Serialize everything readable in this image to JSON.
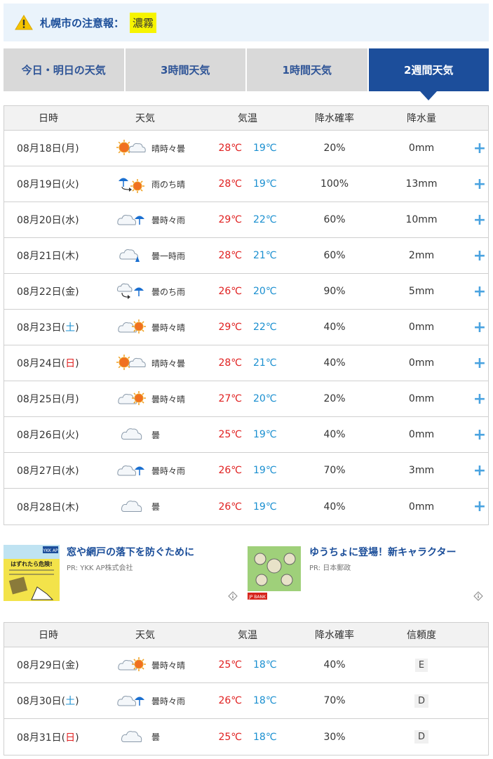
{
  "alert": {
    "label": "札幌市の注意報：",
    "badge": "濃霧",
    "icon": "warning-icon"
  },
  "tabs": [
    {
      "label": "今日・明日の天気",
      "active": false
    },
    {
      "label": "3時間天気",
      "active": false
    },
    {
      "label": "1時間天気",
      "active": false
    },
    {
      "label": "2週間天気",
      "active": true
    }
  ],
  "table1": {
    "headers": {
      "date": "日時",
      "weather": "天気",
      "temp": "気温",
      "pop": "降水確率",
      "amount": "降水量"
    },
    "rows": [
      {
        "date": "08月18日(",
        "dow": "月",
        "tail": ")",
        "icon": "sun-cloud-icon",
        "weather": "晴時々曇",
        "hi": "28℃",
        "lo": "19℃",
        "pop": "20%",
        "amount": "0mm"
      },
      {
        "date": "08月19日(",
        "dow": "火",
        "tail": ")",
        "icon": "rain-then-sun-icon",
        "weather": "雨のち晴",
        "hi": "28℃",
        "lo": "19℃",
        "pop": "100%",
        "amount": "13mm"
      },
      {
        "date": "08月20日(",
        "dow": "水",
        "tail": ")",
        "icon": "cloud-rain-icon",
        "weather": "曇時々雨",
        "hi": "29℃",
        "lo": "22℃",
        "pop": "60%",
        "amount": "10mm"
      },
      {
        "date": "08月21日(",
        "dow": "木",
        "tail": ")",
        "icon": "cloud-shower-icon",
        "weather": "曇一時雨",
        "hi": "28℃",
        "lo": "21℃",
        "pop": "60%",
        "amount": "2mm"
      },
      {
        "date": "08月22日(",
        "dow": "金",
        "tail": ")",
        "icon": "cloud-then-rain-icon",
        "weather": "曇のち雨",
        "hi": "26℃",
        "lo": "20℃",
        "pop": "90%",
        "amount": "5mm"
      },
      {
        "date": "08月23日(",
        "dow": "土",
        "tail": ")",
        "icon": "cloud-sun-icon",
        "weather": "曇時々晴",
        "hi": "29℃",
        "lo": "22℃",
        "pop": "40%",
        "amount": "0mm"
      },
      {
        "date": "08月24日(",
        "dow": "日",
        "tail": ")",
        "icon": "sun-cloud-icon",
        "weather": "晴時々曇",
        "hi": "28℃",
        "lo": "21℃",
        "pop": "40%",
        "amount": "0mm"
      },
      {
        "date": "08月25日(",
        "dow": "月",
        "tail": ")",
        "icon": "cloud-sun-icon",
        "weather": "曇時々晴",
        "hi": "27℃",
        "lo": "20℃",
        "pop": "20%",
        "amount": "0mm"
      },
      {
        "date": "08月26日(",
        "dow": "火",
        "tail": ")",
        "icon": "cloud-icon",
        "weather": "曇",
        "hi": "25℃",
        "lo": "19℃",
        "pop": "40%",
        "amount": "0mm"
      },
      {
        "date": "08月27日(",
        "dow": "水",
        "tail": ")",
        "icon": "cloud-rain-icon",
        "weather": "曇時々雨",
        "hi": "26℃",
        "lo": "19℃",
        "pop": "70%",
        "amount": "3mm"
      },
      {
        "date": "08月28日(",
        "dow": "木",
        "tail": ")",
        "icon": "cloud-icon",
        "weather": "曇",
        "hi": "26℃",
        "lo": "19℃",
        "pop": "40%",
        "amount": "0mm"
      }
    ],
    "expand_label": "+"
  },
  "ads": [
    {
      "title": "窓や網戸の落下を防ぐために",
      "pr": "PR: YKK AP株式会社",
      "thumb_text": "はずれたら危険!",
      "thumb_brand": "YKK AP"
    },
    {
      "title": "ゆうちょに登場！新キャラクター",
      "pr": "PR: 日本郵政",
      "thumb_brand": "JP BANK"
    }
  ],
  "table2": {
    "headers": {
      "date": "日時",
      "weather": "天気",
      "temp": "気温",
      "pop": "降水確率",
      "conf": "信頼度"
    },
    "rows": [
      {
        "date": "08月29日(",
        "dow": "金",
        "tail": ")",
        "icon": "cloud-sun-icon",
        "weather": "曇時々晴",
        "hi": "25℃",
        "lo": "18℃",
        "pop": "40%",
        "conf": "E"
      },
      {
        "date": "08月30日(",
        "dow": "土",
        "tail": ")",
        "icon": "cloud-rain-icon",
        "weather": "曇時々雨",
        "hi": "26℃",
        "lo": "18℃",
        "pop": "70%",
        "conf": "D"
      },
      {
        "date": "08月31日(",
        "dow": "日",
        "tail": ")",
        "icon": "cloud-icon",
        "weather": "曇",
        "hi": "25℃",
        "lo": "18℃",
        "pop": "30%",
        "conf": "D"
      }
    ]
  },
  "colors": {
    "accent": "#1c4e9b",
    "hi_temp": "#e02020",
    "lo_temp": "#1a8fd0",
    "badge": "#f6f400",
    "plus": "#4aa3e0"
  }
}
